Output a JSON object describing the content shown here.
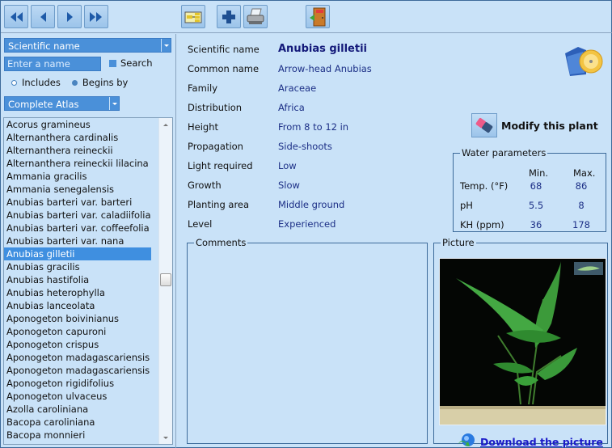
{
  "toolbar": {
    "buttons": [
      {
        "name": "first-record",
        "icon": "double-left-arrow-icon"
      },
      {
        "name": "previous-record",
        "icon": "left-arrow-icon"
      },
      {
        "name": "next-record",
        "icon": "right-arrow-icon"
      },
      {
        "name": "last-record",
        "icon": "double-right-arrow-icon"
      },
      {
        "name": "tree-view",
        "icon": "tree-structure-icon"
      },
      {
        "name": "add",
        "icon": "plus-icon"
      },
      {
        "name": "print",
        "icon": "printer-icon"
      },
      {
        "name": "exit",
        "icon": "exit-door-icon"
      }
    ]
  },
  "sidebar": {
    "search_field_select": "Scientific name",
    "name_input_placeholder": "Enter a name",
    "search_checkbox_label": "Search",
    "radio_includes": "Includes",
    "radio_begins_by": "Begins by",
    "radio_selected": "Begins by",
    "atlas_select": "Complete Atlas",
    "plants": [
      "Acorus gramineus",
      "Alternanthera cardinalis",
      "Alternanthera reineckii",
      "Alternanthera reineckii lilacina",
      "Ammania gracilis",
      "Ammania senegalensis",
      "Anubias barteri var. barteri",
      "Anubias barteri var. caladiifolia",
      "Anubias barteri var. coffeefolia",
      "Anubias barteri var. nana",
      "Anubias gilletii",
      "Anubias gracilis",
      "Anubias hastifolia",
      "Anubias heterophylla",
      "Anubias lanceolata",
      "Aponogeton boivinianus",
      "Aponogeton capuroni",
      "Aponogeton crispus",
      "Aponogeton madagascariensis",
      "Aponogeton madagascariensis",
      "Aponogeton rigidifolius",
      "Aponogeton ulvaceus",
      "Azolla caroliniana",
      "Bacopa caroliniana",
      "Bacopa monnieri"
    ],
    "selected_index": 10
  },
  "details": {
    "fields": [
      {
        "label": "Scientific name",
        "value": "Anubias gilletii"
      },
      {
        "label": "Common name",
        "value": "Arrow-head Anubias"
      },
      {
        "label": "Family",
        "value": "Araceae"
      },
      {
        "label": "Distribution",
        "value": "Africa"
      },
      {
        "label": "Height",
        "value": "From 8 to 12 in"
      },
      {
        "label": "Propagation",
        "value": "Side-shoots"
      },
      {
        "label": "Light required",
        "value": "Low"
      },
      {
        "label": "Growth",
        "value": "Slow"
      },
      {
        "label": "Planting area",
        "value": "Middle ground"
      },
      {
        "label": "Level",
        "value": "Experienced"
      }
    ],
    "modify_label": "Modify this plant",
    "water": {
      "title": "Water parameters",
      "min_header": "Min.",
      "max_header": "Max.",
      "rows": [
        {
          "label": "Temp. (°F)",
          "min": "68",
          "max": "86"
        },
        {
          "label": "pH",
          "min": "5.5",
          "max": "8"
        },
        {
          "label": "KH (ppm)",
          "min": "36",
          "max": "178"
        }
      ]
    },
    "comments_title": "Comments",
    "comments_text": "",
    "picture_title": "Picture",
    "download_label": "Download the picture"
  }
}
